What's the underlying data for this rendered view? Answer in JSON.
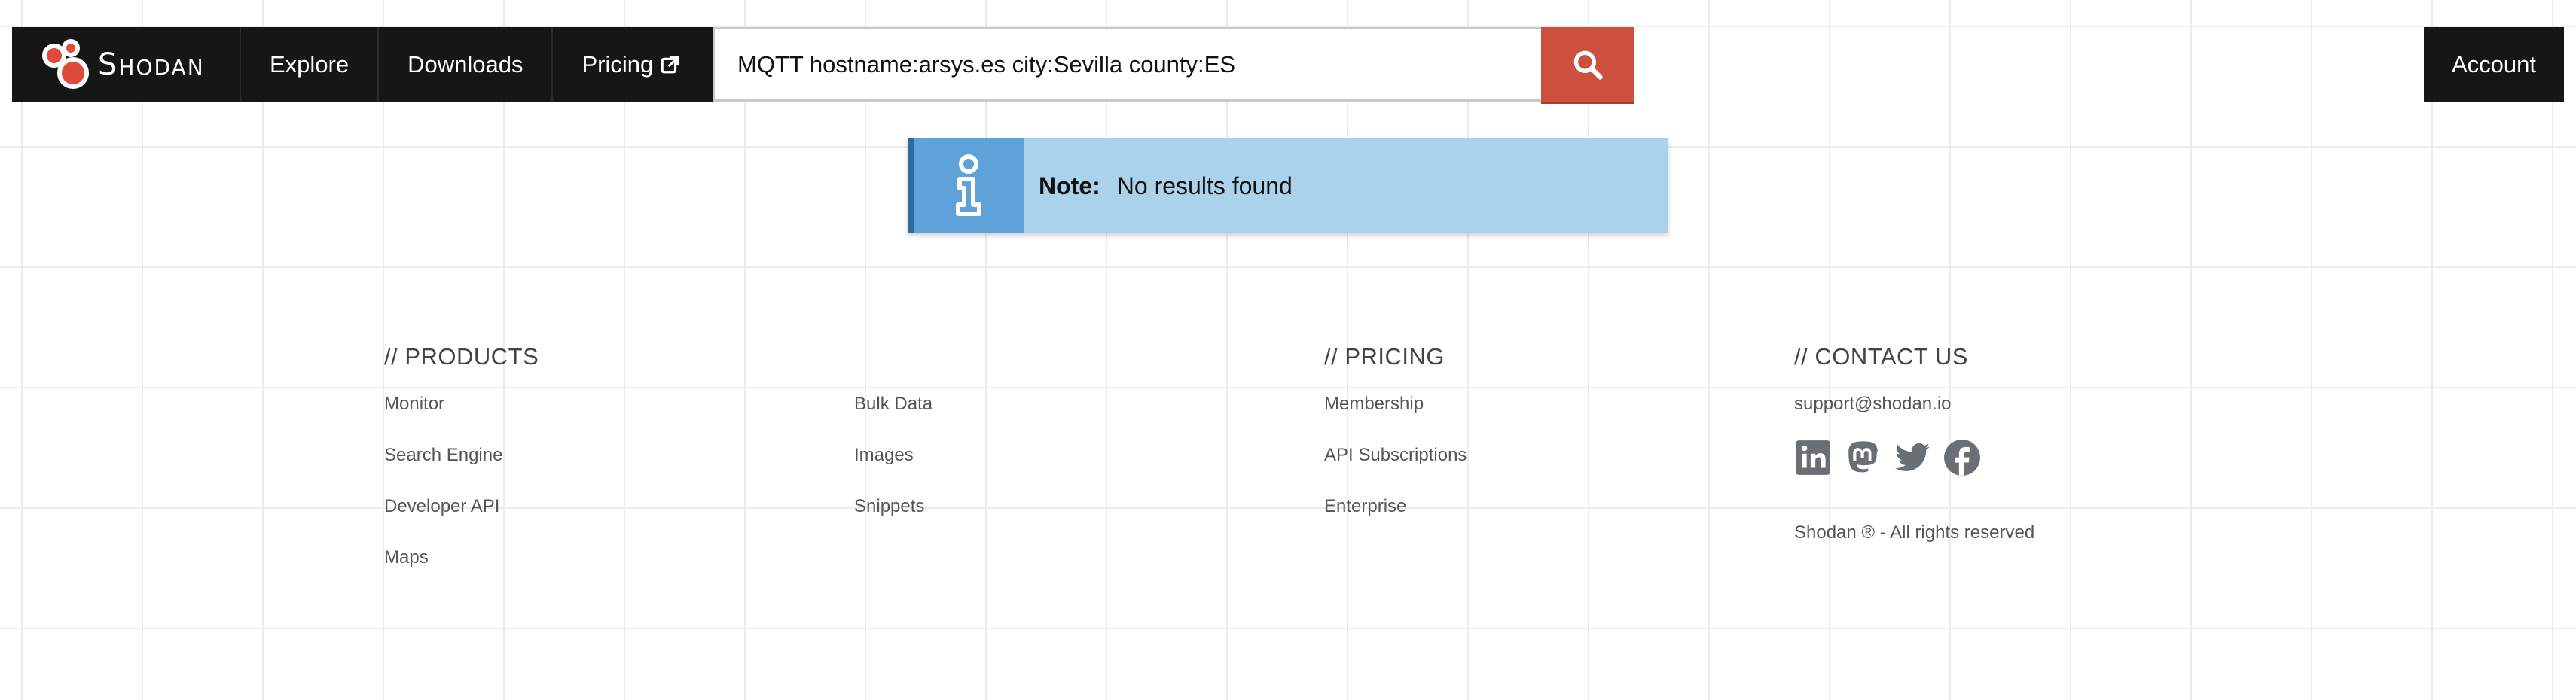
{
  "navbar": {
    "brand": "Shodan",
    "items": [
      {
        "label": "Explore"
      },
      {
        "label": "Downloads"
      },
      {
        "label": "Pricing"
      }
    ],
    "account_label": "Account"
  },
  "search": {
    "value": "MQTT hostname:arsys.es city:Sevilla county:ES"
  },
  "note": {
    "label": "Note:",
    "text": "No results found"
  },
  "footer": {
    "products": {
      "heading": "// PRODUCTS",
      "col1": [
        "Monitor",
        "Search Engine",
        "Developer API",
        "Maps"
      ],
      "col2": [
        "Bulk Data",
        "Images",
        "Snippets"
      ]
    },
    "pricing": {
      "heading": "// PRICING",
      "links": [
        "Membership",
        "API Subscriptions",
        "Enterprise"
      ]
    },
    "contact": {
      "heading": "// CONTACT US",
      "email": "support@shodan.io",
      "social_icons": [
        "linkedin-icon",
        "mastodon-icon",
        "twitter-icon",
        "facebook-icon"
      ],
      "copyright": "Shodan ® - All rights reserved"
    }
  },
  "colors": {
    "navbar": "#161616",
    "search_button": "#cd503f",
    "note_bg": "#aad2ea",
    "note_icon_bg": "#5ea2d9",
    "social_icon": "#6a6f75"
  }
}
